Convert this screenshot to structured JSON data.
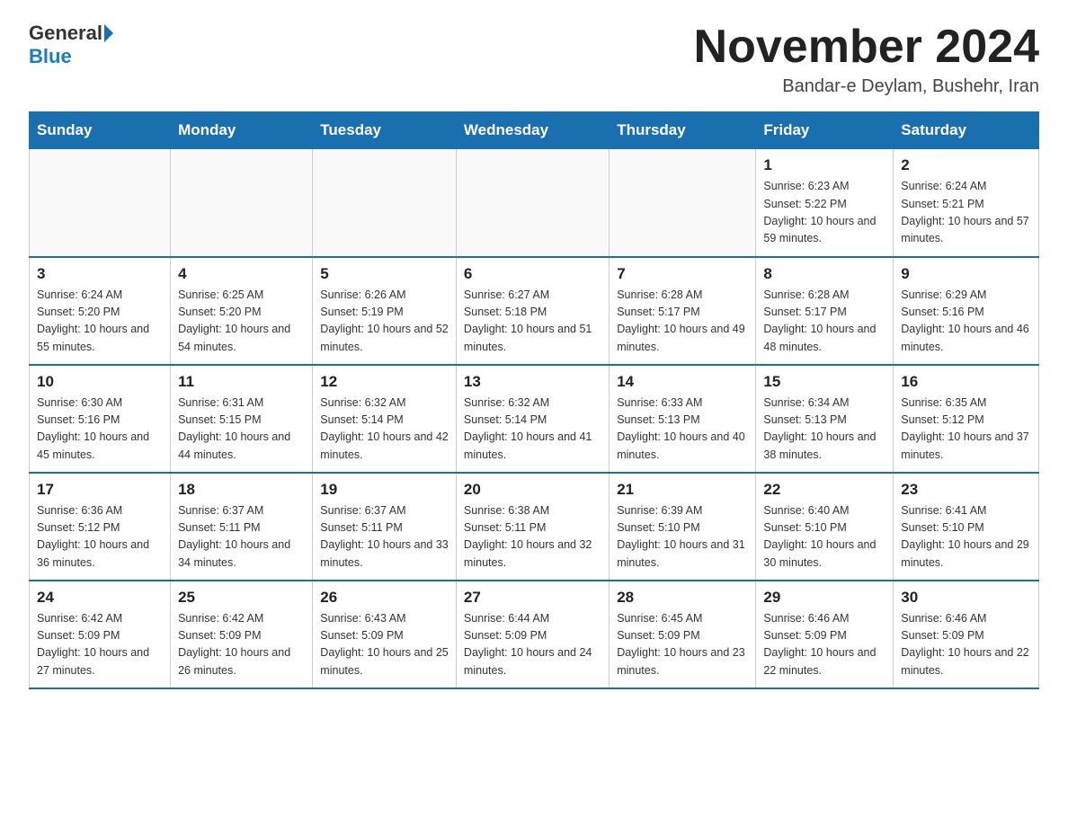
{
  "header": {
    "logo_general": "General",
    "logo_blue": "Blue",
    "title": "November 2024",
    "subtitle": "Bandar-e Deylam, Bushehr, Iran"
  },
  "days_of_week": [
    "Sunday",
    "Monday",
    "Tuesday",
    "Wednesday",
    "Thursday",
    "Friday",
    "Saturday"
  ],
  "weeks": [
    [
      {
        "day": "",
        "info": ""
      },
      {
        "day": "",
        "info": ""
      },
      {
        "day": "",
        "info": ""
      },
      {
        "day": "",
        "info": ""
      },
      {
        "day": "",
        "info": ""
      },
      {
        "day": "1",
        "info": "Sunrise: 6:23 AM\nSunset: 5:22 PM\nDaylight: 10 hours and 59 minutes."
      },
      {
        "day": "2",
        "info": "Sunrise: 6:24 AM\nSunset: 5:21 PM\nDaylight: 10 hours and 57 minutes."
      }
    ],
    [
      {
        "day": "3",
        "info": "Sunrise: 6:24 AM\nSunset: 5:20 PM\nDaylight: 10 hours and 55 minutes."
      },
      {
        "day": "4",
        "info": "Sunrise: 6:25 AM\nSunset: 5:20 PM\nDaylight: 10 hours and 54 minutes."
      },
      {
        "day": "5",
        "info": "Sunrise: 6:26 AM\nSunset: 5:19 PM\nDaylight: 10 hours and 52 minutes."
      },
      {
        "day": "6",
        "info": "Sunrise: 6:27 AM\nSunset: 5:18 PM\nDaylight: 10 hours and 51 minutes."
      },
      {
        "day": "7",
        "info": "Sunrise: 6:28 AM\nSunset: 5:17 PM\nDaylight: 10 hours and 49 minutes."
      },
      {
        "day": "8",
        "info": "Sunrise: 6:28 AM\nSunset: 5:17 PM\nDaylight: 10 hours and 48 minutes."
      },
      {
        "day": "9",
        "info": "Sunrise: 6:29 AM\nSunset: 5:16 PM\nDaylight: 10 hours and 46 minutes."
      }
    ],
    [
      {
        "day": "10",
        "info": "Sunrise: 6:30 AM\nSunset: 5:16 PM\nDaylight: 10 hours and 45 minutes."
      },
      {
        "day": "11",
        "info": "Sunrise: 6:31 AM\nSunset: 5:15 PM\nDaylight: 10 hours and 44 minutes."
      },
      {
        "day": "12",
        "info": "Sunrise: 6:32 AM\nSunset: 5:14 PM\nDaylight: 10 hours and 42 minutes."
      },
      {
        "day": "13",
        "info": "Sunrise: 6:32 AM\nSunset: 5:14 PM\nDaylight: 10 hours and 41 minutes."
      },
      {
        "day": "14",
        "info": "Sunrise: 6:33 AM\nSunset: 5:13 PM\nDaylight: 10 hours and 40 minutes."
      },
      {
        "day": "15",
        "info": "Sunrise: 6:34 AM\nSunset: 5:13 PM\nDaylight: 10 hours and 38 minutes."
      },
      {
        "day": "16",
        "info": "Sunrise: 6:35 AM\nSunset: 5:12 PM\nDaylight: 10 hours and 37 minutes."
      }
    ],
    [
      {
        "day": "17",
        "info": "Sunrise: 6:36 AM\nSunset: 5:12 PM\nDaylight: 10 hours and 36 minutes."
      },
      {
        "day": "18",
        "info": "Sunrise: 6:37 AM\nSunset: 5:11 PM\nDaylight: 10 hours and 34 minutes."
      },
      {
        "day": "19",
        "info": "Sunrise: 6:37 AM\nSunset: 5:11 PM\nDaylight: 10 hours and 33 minutes."
      },
      {
        "day": "20",
        "info": "Sunrise: 6:38 AM\nSunset: 5:11 PM\nDaylight: 10 hours and 32 minutes."
      },
      {
        "day": "21",
        "info": "Sunrise: 6:39 AM\nSunset: 5:10 PM\nDaylight: 10 hours and 31 minutes."
      },
      {
        "day": "22",
        "info": "Sunrise: 6:40 AM\nSunset: 5:10 PM\nDaylight: 10 hours and 30 minutes."
      },
      {
        "day": "23",
        "info": "Sunrise: 6:41 AM\nSunset: 5:10 PM\nDaylight: 10 hours and 29 minutes."
      }
    ],
    [
      {
        "day": "24",
        "info": "Sunrise: 6:42 AM\nSunset: 5:09 PM\nDaylight: 10 hours and 27 minutes."
      },
      {
        "day": "25",
        "info": "Sunrise: 6:42 AM\nSunset: 5:09 PM\nDaylight: 10 hours and 26 minutes."
      },
      {
        "day": "26",
        "info": "Sunrise: 6:43 AM\nSunset: 5:09 PM\nDaylight: 10 hours and 25 minutes."
      },
      {
        "day": "27",
        "info": "Sunrise: 6:44 AM\nSunset: 5:09 PM\nDaylight: 10 hours and 24 minutes."
      },
      {
        "day": "28",
        "info": "Sunrise: 6:45 AM\nSunset: 5:09 PM\nDaylight: 10 hours and 23 minutes."
      },
      {
        "day": "29",
        "info": "Sunrise: 6:46 AM\nSunset: 5:09 PM\nDaylight: 10 hours and 22 minutes."
      },
      {
        "day": "30",
        "info": "Sunrise: 6:46 AM\nSunset: 5:09 PM\nDaylight: 10 hours and 22 minutes."
      }
    ]
  ]
}
